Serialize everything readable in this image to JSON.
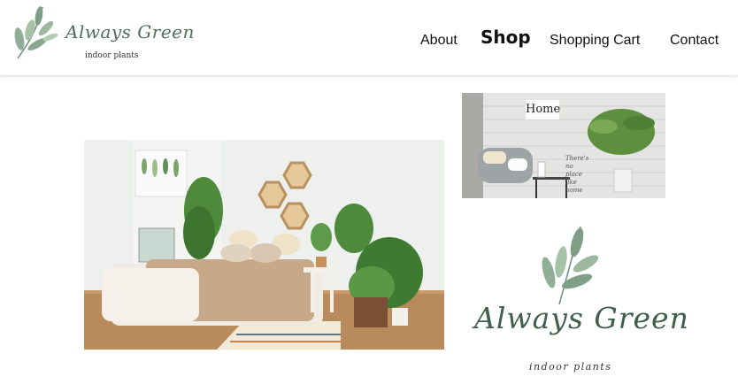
{
  "brand": {
    "name": "Always Green",
    "tagline": "indoor plants"
  },
  "nav": {
    "items": [
      {
        "label": "About",
        "active": false
      },
      {
        "label": "Shop",
        "active": true
      },
      {
        "label": "Shopping Cart",
        "active": false
      },
      {
        "label": "Contact",
        "active": false
      }
    ]
  },
  "images": {
    "home_photo": {
      "sign_text": "Home",
      "wall_text": "There's no place like home"
    }
  },
  "colors": {
    "leaf": "#7e9f85",
    "brand_text": "#4e6e5a",
    "active_nav": "#000000"
  },
  "icons": {
    "logo": "leaf-branch-icon"
  }
}
